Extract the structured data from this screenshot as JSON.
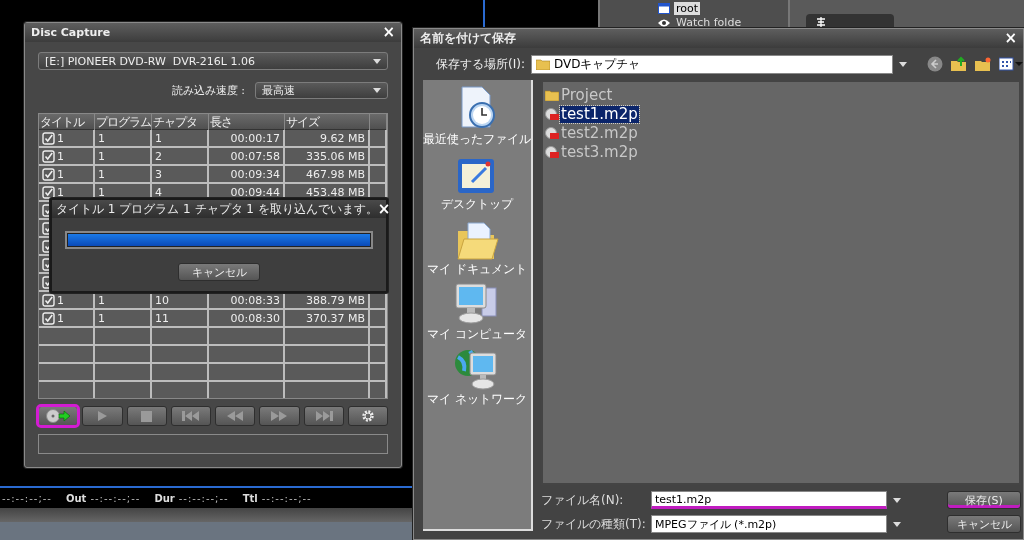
{
  "background_app": {
    "tree": [
      {
        "label": "root",
        "selected": true
      },
      {
        "label": "Watch folde",
        "selected": false
      }
    ],
    "timecode": [
      {
        "value": "--:--:--;--"
      },
      {
        "label": "Out",
        "value": "--:--:--;--"
      },
      {
        "label": "Dur",
        "value": "--:--:--;--"
      },
      {
        "label": "Ttl",
        "value": "--:--:--;--"
      }
    ]
  },
  "disc_capture": {
    "title": "Disc Capture",
    "close": "×",
    "drive": "[E:] PIONEER DVD-RW  DVR-216L 1.06",
    "speed_label": "読み込み速度 :",
    "speed": "最高速",
    "table": {
      "columns": [
        "タイトル",
        "プログラム",
        "チャプタ",
        "長さ",
        "サイズ"
      ],
      "rows": [
        {
          "checked": true,
          "cells": [
            "1",
            "1",
            "1",
            "00:00:17",
            "9.62 MB"
          ]
        },
        {
          "checked": true,
          "cells": [
            "1",
            "1",
            "2",
            "00:07:58",
            "335.06 MB"
          ]
        },
        {
          "checked": true,
          "cells": [
            "1",
            "1",
            "3",
            "00:09:34",
            "467.98 MB"
          ]
        },
        {
          "checked": true,
          "cells": [
            "1",
            "1",
            "4",
            "00:09:44",
            "453.48 MB"
          ]
        },
        {
          "checked": true
        },
        {
          "checked": true
        },
        {
          "checked": true
        },
        {
          "checked": true
        },
        {
          "checked": true
        },
        {
          "checked": true,
          "cells": [
            "1",
            "1",
            "10",
            "00:08:33",
            "388.79 MB"
          ]
        },
        {
          "checked": true,
          "cells": [
            "1",
            "1",
            "11",
            "00:08:30",
            "370.37 MB"
          ]
        }
      ]
    },
    "controls": [
      {
        "kind": "capture",
        "highlighted": true
      },
      {
        "kind": "play",
        "highlighted": false
      },
      {
        "kind": "stop",
        "highlighted": false
      },
      {
        "kind": "first",
        "highlighted": false
      },
      {
        "kind": "rewind",
        "highlighted": false
      },
      {
        "kind": "forward",
        "highlighted": false
      },
      {
        "kind": "last",
        "highlighted": false
      },
      {
        "kind": "settings",
        "highlighted": false
      }
    ]
  },
  "progress_dialog": {
    "message": "タイトル 1 プログラム 1 チャプタ 1 を取り込んでいます。",
    "close": "×",
    "level": 1,
    "cancel": "キャンセル"
  },
  "save_dialog": {
    "title": "名前を付けて保存",
    "close": "×",
    "location_label": "保存する場所(I):",
    "location": "DVDキャプチャ",
    "places": [
      {
        "kind": "recent",
        "label": "最近使ったファイル"
      },
      {
        "kind": "desktop",
        "label": "デスクトップ"
      },
      {
        "kind": "documents",
        "label": "マイ ドキュメント"
      },
      {
        "kind": "computer",
        "label": "マイ コンピュータ"
      },
      {
        "kind": "network",
        "label": "マイ ネットワーク"
      }
    ],
    "files": [
      {
        "kind": "folder",
        "name": "Project",
        "selected": false
      },
      {
        "kind": "video",
        "name": "test1.m2p",
        "selected": true
      },
      {
        "kind": "video",
        "name": "test2.m2p",
        "selected": false
      },
      {
        "kind": "video",
        "name": "test3.m2p",
        "selected": false
      }
    ],
    "filename_label": "ファイル名(N):",
    "filename": "test1.m2p",
    "filename_highlighted": true,
    "filetype_label": "ファイルの種類(T):",
    "filetype": "MPEGファイル (*.m2p)",
    "buttons": [
      {
        "label": "保存(S)",
        "highlighted": true
      },
      {
        "label": "キャンセル",
        "highlighted": false
      }
    ]
  }
}
